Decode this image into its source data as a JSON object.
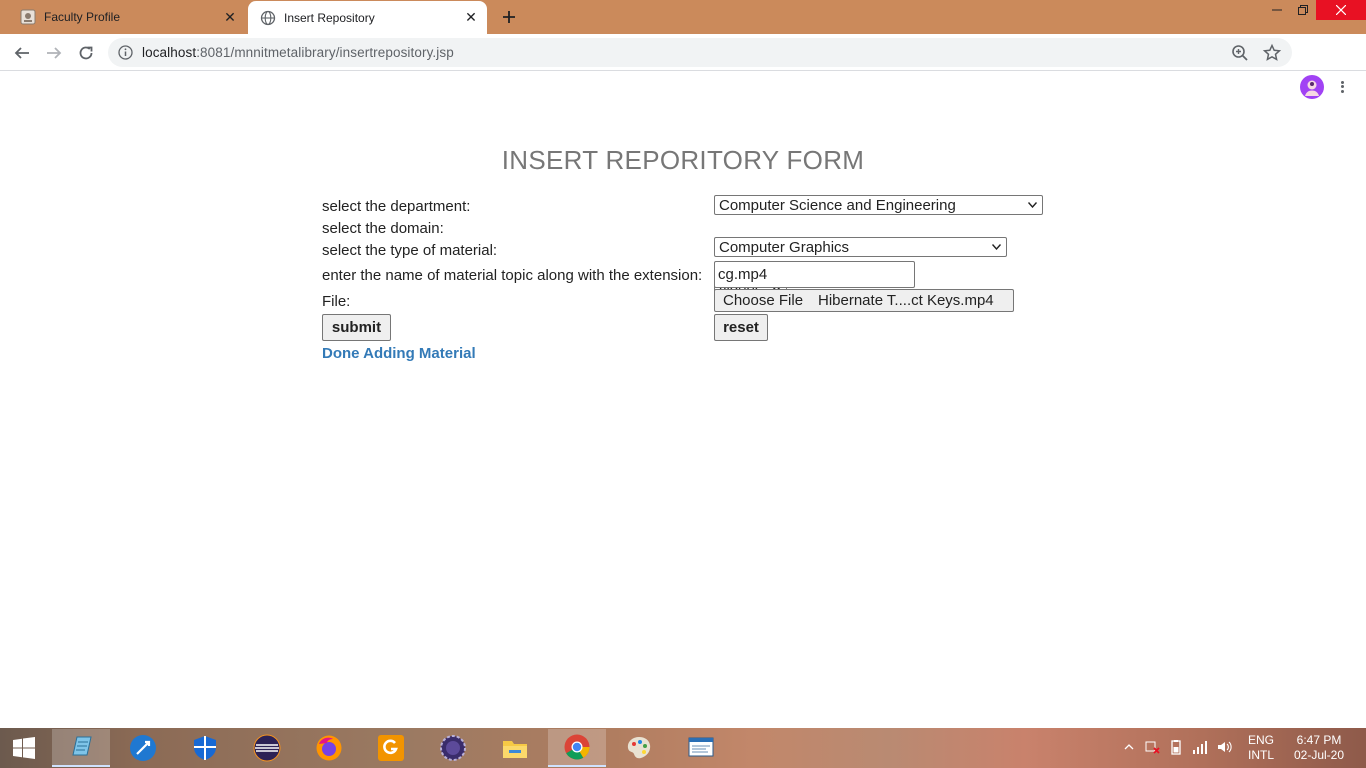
{
  "browser": {
    "tabs": [
      {
        "label": "Faculty Profile",
        "active": false
      },
      {
        "label": "Insert Repository",
        "active": true
      }
    ],
    "url_host": "localhost",
    "url_rest": ":8081/mnnitmetalibrary/insertrepository.jsp"
  },
  "form": {
    "title": "INSERT REPORITORY FORM",
    "department_label": "select the department:",
    "department_value": "Computer Science and Engineering",
    "domain_label": "select the domain:",
    "domain_value": "Computer Graphics",
    "type_label": "select the type of material:",
    "type_value": "videos",
    "topic_label": "enter the name of material topic along with the extension:",
    "topic_value": "cg.mp4",
    "file_label": "File:",
    "choose_file_label": "Choose File",
    "file_name": "Hibernate T....ct Keys.mp4",
    "submit_label": "submit",
    "reset_label": "reset",
    "done_link": "Done Adding Material"
  },
  "taskbar": {
    "apps": [
      "start",
      "notepad",
      "network-tool",
      "defender",
      "eclipse",
      "firefox",
      "pdf-reader",
      "java-ee-ide",
      "file-explorer",
      "chrome",
      "paint",
      "monitor"
    ],
    "active_app": "chrome",
    "lang_top": "ENG",
    "lang_bottom": "INTL",
    "time": "6:47 PM",
    "date": "02-Jul-20"
  },
  "colors": {
    "tabstrip": "#cb8a5b",
    "link": "#337ab7",
    "close_button": "#e81123"
  }
}
